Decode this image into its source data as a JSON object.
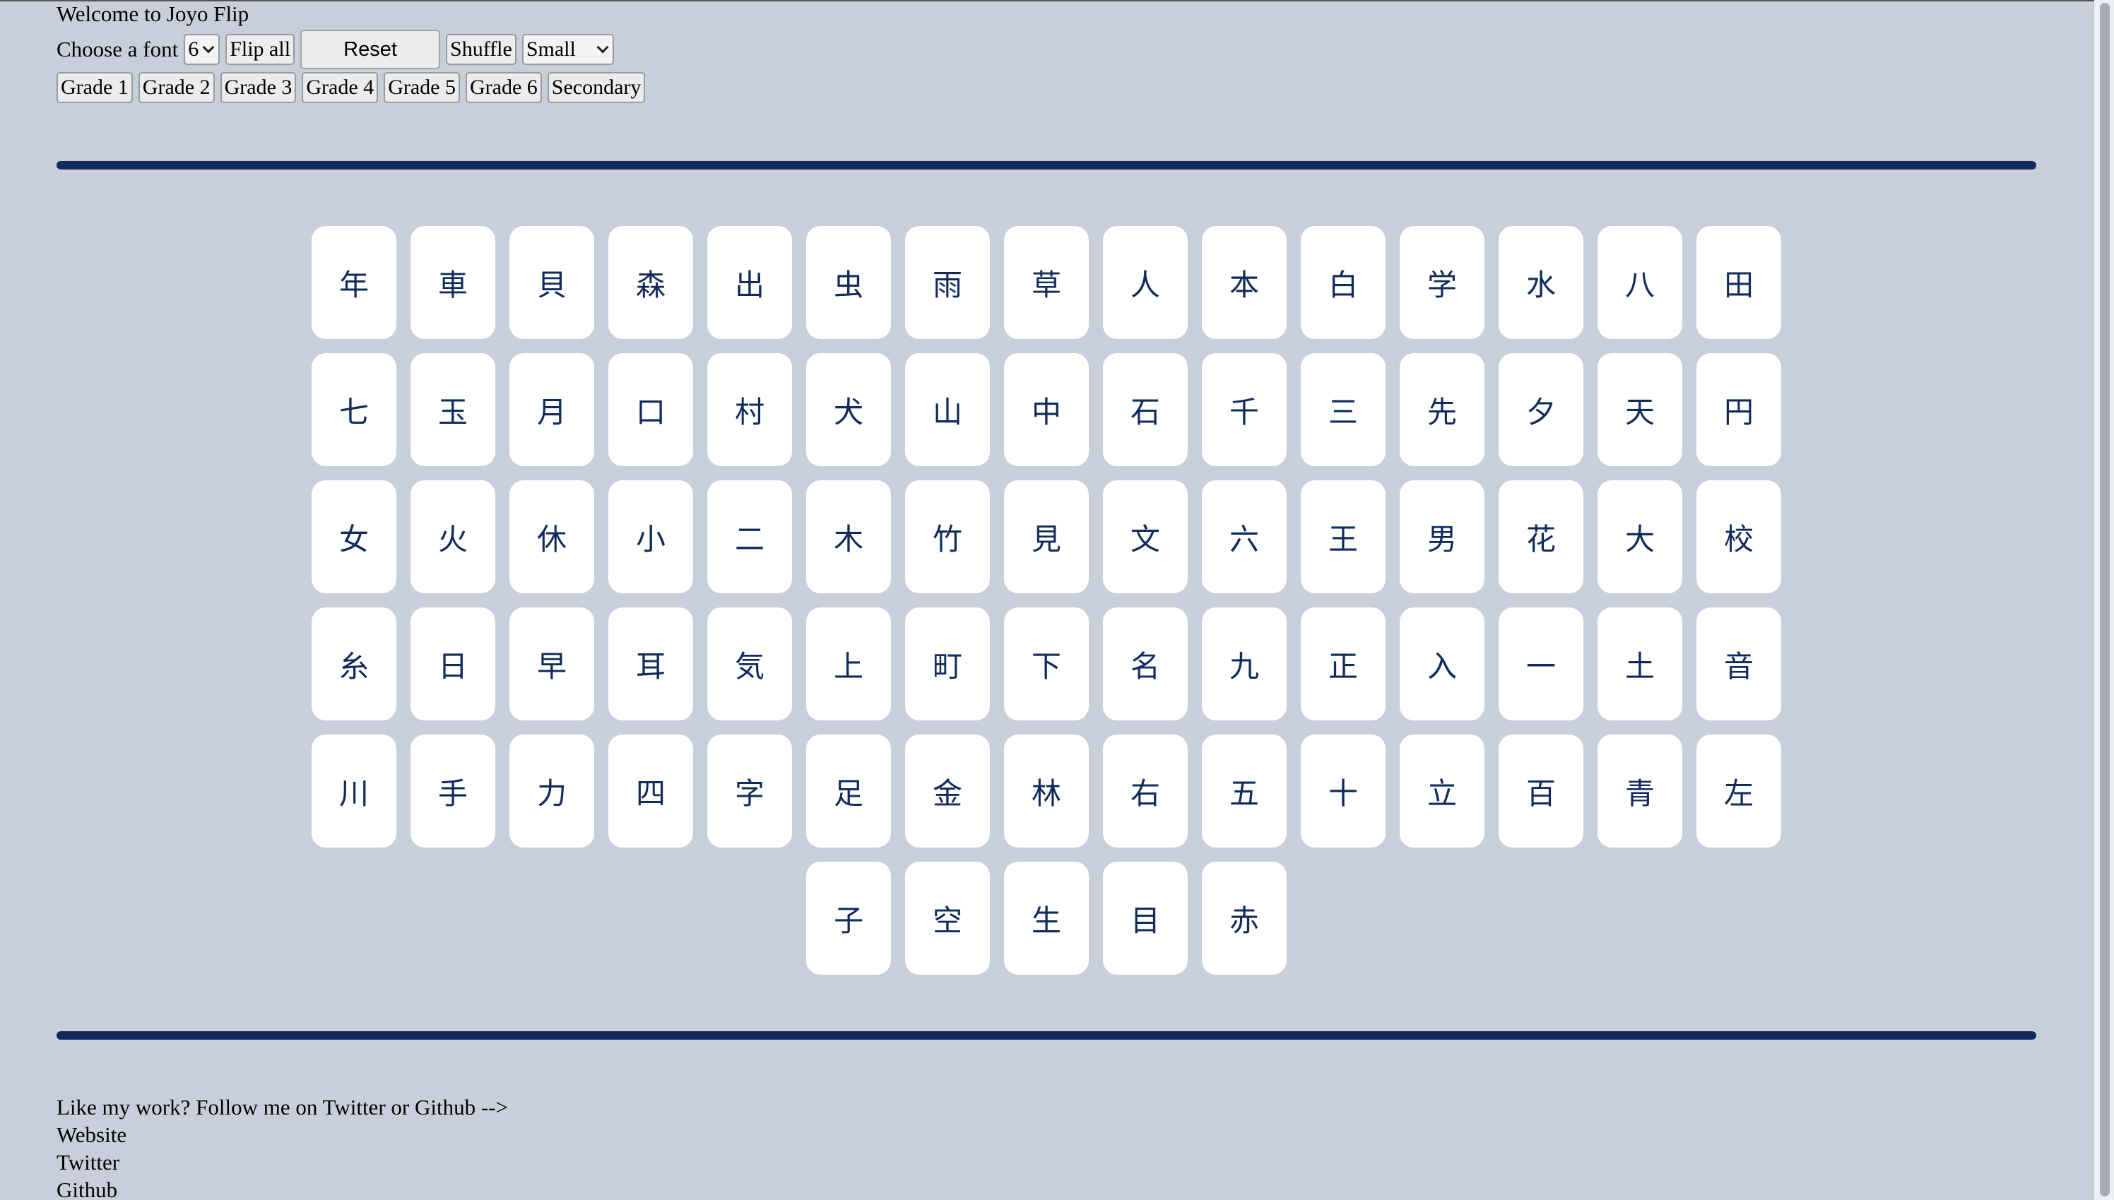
{
  "header": {
    "welcome": "Welcome to Joyo Flip",
    "font_label": "Choose a font",
    "font_select_value": "6",
    "flip_all": "Flip all",
    "reset": "Reset",
    "shuffle": "Shuffle",
    "size_select_value": "Small"
  },
  "grades": [
    "Grade 1",
    "Grade 2",
    "Grade 3",
    "Grade 4",
    "Grade 5",
    "Grade 6",
    "Secondary"
  ],
  "cards": [
    "年",
    "車",
    "貝",
    "森",
    "出",
    "虫",
    "雨",
    "草",
    "人",
    "本",
    "白",
    "学",
    "水",
    "八",
    "田",
    "七",
    "玉",
    "月",
    "口",
    "村",
    "犬",
    "山",
    "中",
    "石",
    "千",
    "三",
    "先",
    "夕",
    "天",
    "円",
    "女",
    "火",
    "休",
    "小",
    "二",
    "木",
    "竹",
    "見",
    "文",
    "六",
    "王",
    "男",
    "花",
    "大",
    "校",
    "糸",
    "日",
    "早",
    "耳",
    "気",
    "上",
    "町",
    "下",
    "名",
    "九",
    "正",
    "入",
    "一",
    "土",
    "音",
    "川",
    "手",
    "力",
    "四",
    "字",
    "足",
    "金",
    "林",
    "右",
    "五",
    "十",
    "立",
    "百",
    "青",
    "左",
    "子",
    "空",
    "生",
    "目",
    "赤"
  ],
  "footer": {
    "follow": "Like my work? Follow me on Twitter or Github -->",
    "website": "Website",
    "twitter": "Twitter",
    "github": "Github"
  },
  "colors": {
    "background": "#c8cfdb",
    "accent": "#102b5c",
    "card": "#ffffff"
  }
}
